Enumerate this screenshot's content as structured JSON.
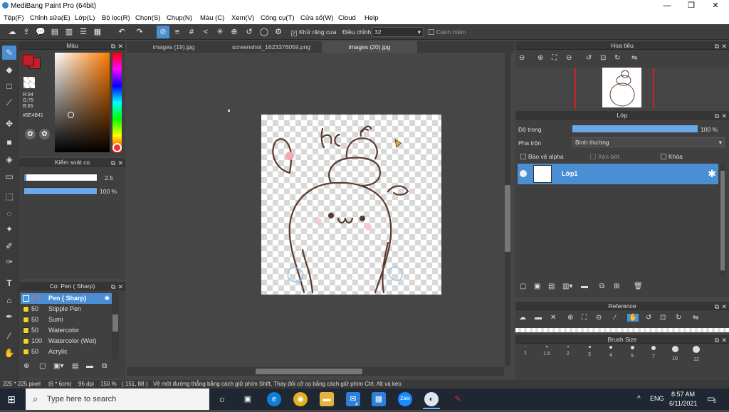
{
  "window": {
    "title": "MediBang Paint Pro (64bit)",
    "minimize": "—",
    "maximize": "❐",
    "close": "✕"
  },
  "menu": [
    "Tệp(F)",
    "Chỉnh sửa(E)",
    "Lớp(L)",
    "Bộ lọc(R)",
    "Chọn(S)",
    "Chụp(N)",
    "Màu (C)",
    "Xem(V)",
    "Công cụ(T)",
    "Cửa sổ(W)",
    "Cloud",
    "Help"
  ],
  "toolbar": {
    "antialias_label": "Khử răng cưa",
    "antialias_checked": true,
    "correction_label": "Điều chỉnh",
    "correction_value": "32",
    "snap_label": "Canh mềm",
    "snap_checked": false
  },
  "tabs": [
    "images (19).jpg",
    "screenshot_1623376059.png",
    "images (20).jpg"
  ],
  "active_tab": 2,
  "color_panel": {
    "title": "Màu",
    "r": "R:94",
    "g": "G:75",
    "b": "B:65",
    "hex": "#5E4B41",
    "fg_color": "#c0202a"
  },
  "brush_control": {
    "title": "Kiểm soát cọ",
    "size": "2.5",
    "opacity": "100 %",
    "opacity_fraction": 1.0
  },
  "brush_panel": {
    "title": "Cọ: Pen ( Sharp)",
    "items": [
      {
        "size": "2.5",
        "name": "Pen ( Sharp)",
        "active": true
      },
      {
        "size": "50",
        "name": "Stipple Pen"
      },
      {
        "size": "50",
        "name": "Sumi"
      },
      {
        "size": "50",
        "name": "Watercolor"
      },
      {
        "size": "100",
        "name": "Watercolor (Wet)"
      },
      {
        "size": "50",
        "name": "Acrylic"
      }
    ]
  },
  "navigator": {
    "title": "Hoa tiêu"
  },
  "layer_panel": {
    "title": "Lớp",
    "opacity_label": "Độ trong",
    "opacity_value": "100 %",
    "opacity_fraction": 1.0,
    "blend_label": "Pha trộn",
    "blend_value": "Bình thường",
    "protect_alpha": "Bảo vệ alpha",
    "clipping": "Xén bớt",
    "lock": "Khóa",
    "layer_name": "Lớp1"
  },
  "reference": {
    "title": "Reference"
  },
  "brush_size": {
    "title": "Brush Size",
    "sizes": [
      "1",
      "1.5",
      "2",
      "3",
      "4",
      "5",
      "7",
      "10",
      "12"
    ]
  },
  "status": {
    "dimensions": "225 * 225 pixel",
    "cm": "(6 * 6cm)",
    "dpi": "96 dpi",
    "zoom": "150 %",
    "coords": "( 151, 88 )",
    "hint": "Vẽ một đường thẳng bằng cách giữ phím Shift, Thay đổi cỡ cọ bằng cách giữ phím Ctrl, Alt và kéo"
  },
  "taskbar": {
    "search_placeholder": "Type here to search",
    "lang": "ENG",
    "time": "8:57 AM",
    "date": "6/11/2021",
    "notif_count": "5",
    "mail_badge": "4"
  },
  "drawing_text": "hc"
}
